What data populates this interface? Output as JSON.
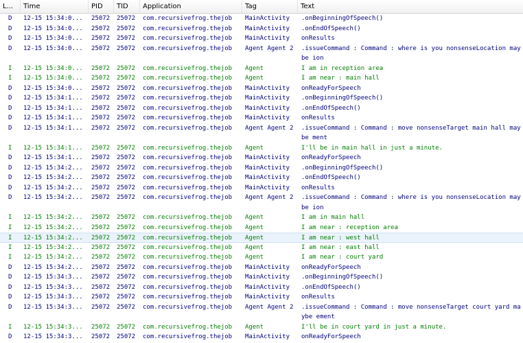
{
  "columns": {
    "level": "L...",
    "time": "Time",
    "pid": "PID",
    "tid": "TID",
    "app": "Application",
    "tag": "Tag",
    "text": "Text"
  },
  "level_colors": {
    "D": "#00007f",
    "I": "#007f00"
  },
  "selected_row_index": 19,
  "rows": [
    {
      "level": "D",
      "time": "12-15 15:34:0...",
      "pid": "25072",
      "tid": "25072",
      "app": "com.recursivefrog.thejob",
      "tag": "MainActivity",
      "text": ".onBeginningOfSpeech()"
    },
    {
      "level": "D",
      "time": "12-15 15:34:0...",
      "pid": "25072",
      "tid": "25072",
      "app": "com.recursivefrog.thejob",
      "tag": "MainActivity",
      "text": ".onEndOfSpeech()"
    },
    {
      "level": "D",
      "time": "12-15 15:34:0...",
      "pid": "25072",
      "tid": "25072",
      "app": "com.recursivefrog.thejob",
      "tag": "MainActivity",
      "text": "onResults"
    },
    {
      "level": "D",
      "time": "12-15 15:34:0...",
      "pid": "25072",
      "tid": "25072",
      "app": "com.recursivefrog.thejob",
      "tag": "Agent Agent 2",
      "text": ".issueCommand : Command : where is you nonsenseLocation maybe ion",
      "wrap": true
    },
    {
      "level": "I",
      "time": "12-15 15:34:0...",
      "pid": "25072",
      "tid": "25072",
      "app": "com.recursivefrog.thejob",
      "tag": "Agent",
      "text": "I am in reception area"
    },
    {
      "level": "I",
      "time": "12-15 15:34:0...",
      "pid": "25072",
      "tid": "25072",
      "app": "com.recursivefrog.thejob",
      "tag": "Agent",
      "text": "I am near : main hall"
    },
    {
      "level": "D",
      "time": "12-15 15:34:0...",
      "pid": "25072",
      "tid": "25072",
      "app": "com.recursivefrog.thejob",
      "tag": "MainActivity",
      "text": "onReadyForSpeech"
    },
    {
      "level": "D",
      "time": "12-15 15:34:1...",
      "pid": "25072",
      "tid": "25072",
      "app": "com.recursivefrog.thejob",
      "tag": "MainActivity",
      "text": ".onBeginningOfSpeech()"
    },
    {
      "level": "D",
      "time": "12-15 15:34:1...",
      "pid": "25072",
      "tid": "25072",
      "app": "com.recursivefrog.thejob",
      "tag": "MainActivity",
      "text": ".onEndOfSpeech()"
    },
    {
      "level": "D",
      "time": "12-15 15:34:1...",
      "pid": "25072",
      "tid": "25072",
      "app": "com.recursivefrog.thejob",
      "tag": "MainActivity",
      "text": "onResults"
    },
    {
      "level": "D",
      "time": "12-15 15:34:1...",
      "pid": "25072",
      "tid": "25072",
      "app": "com.recursivefrog.thejob",
      "tag": "Agent Agent 2",
      "text": ".issueCommand : Command : move nonsenseTarget main hall maybe ment",
      "wrap": true
    },
    {
      "level": "I",
      "time": "12-15 15:34:1...",
      "pid": "25072",
      "tid": "25072",
      "app": "com.recursivefrog.thejob",
      "tag": "Agent",
      "text": "I'll be in main hall in just a minute."
    },
    {
      "level": "D",
      "time": "12-15 15:34:1...",
      "pid": "25072",
      "tid": "25072",
      "app": "com.recursivefrog.thejob",
      "tag": "MainActivity",
      "text": "onReadyForSpeech"
    },
    {
      "level": "D",
      "time": "12-15 15:34:2...",
      "pid": "25072",
      "tid": "25072",
      "app": "com.recursivefrog.thejob",
      "tag": "MainActivity",
      "text": ".onBeginningOfSpeech()"
    },
    {
      "level": "D",
      "time": "12-15 15:34:2...",
      "pid": "25072",
      "tid": "25072",
      "app": "com.recursivefrog.thejob",
      "tag": "MainActivity",
      "text": ".onEndOfSpeech()"
    },
    {
      "level": "D",
      "time": "12-15 15:34:2...",
      "pid": "25072",
      "tid": "25072",
      "app": "com.recursivefrog.thejob",
      "tag": "MainActivity",
      "text": "onResults"
    },
    {
      "level": "D",
      "time": "12-15 15:34:2...",
      "pid": "25072",
      "tid": "25072",
      "app": "com.recursivefrog.thejob",
      "tag": "Agent Agent 2",
      "text": ".issueCommand : Command : where is you nonsenseLocation maybe ion",
      "wrap": true
    },
    {
      "level": "I",
      "time": "12-15 15:34:2...",
      "pid": "25072",
      "tid": "25072",
      "app": "com.recursivefrog.thejob",
      "tag": "Agent",
      "text": "I am in main hall"
    },
    {
      "level": "I",
      "time": "12-15 15:34:2...",
      "pid": "25072",
      "tid": "25072",
      "app": "com.recursivefrog.thejob",
      "tag": "Agent",
      "text": "I am near : reception area"
    },
    {
      "level": "I",
      "time": "12-15 15:34:2...",
      "pid": "25072",
      "tid": "25072",
      "app": "com.recursivefrog.thejob",
      "tag": "Agent",
      "text": "I am near : west hall"
    },
    {
      "level": "I",
      "time": "12-15 15:34:2...",
      "pid": "25072",
      "tid": "25072",
      "app": "com.recursivefrog.thejob",
      "tag": "Agent",
      "text": "I am near : east hall"
    },
    {
      "level": "I",
      "time": "12-15 15:34:2...",
      "pid": "25072",
      "tid": "25072",
      "app": "com.recursivefrog.thejob",
      "tag": "Agent",
      "text": "I am near : court yard"
    },
    {
      "level": "D",
      "time": "12-15 15:34:2...",
      "pid": "25072",
      "tid": "25072",
      "app": "com.recursivefrog.thejob",
      "tag": "MainActivity",
      "text": "onReadyForSpeech"
    },
    {
      "level": "D",
      "time": "12-15 15:34:3...",
      "pid": "25072",
      "tid": "25072",
      "app": "com.recursivefrog.thejob",
      "tag": "MainActivity",
      "text": ".onBeginningOfSpeech()"
    },
    {
      "level": "D",
      "time": "12-15 15:34:3...",
      "pid": "25072",
      "tid": "25072",
      "app": "com.recursivefrog.thejob",
      "tag": "MainActivity",
      "text": ".onEndOfSpeech()"
    },
    {
      "level": "D",
      "time": "12-15 15:34:3...",
      "pid": "25072",
      "tid": "25072",
      "app": "com.recursivefrog.thejob",
      "tag": "MainActivity",
      "text": "onResults"
    },
    {
      "level": "D",
      "time": "12-15 15:34:3...",
      "pid": "25072",
      "tid": "25072",
      "app": "com.recursivefrog.thejob",
      "tag": "Agent Agent 2",
      "text": ".issueCommand : Command : move nonsenseTarget court yard maybe ement",
      "wrap": true
    },
    {
      "level": "I",
      "time": "12-15 15:34:3...",
      "pid": "25072",
      "tid": "25072",
      "app": "com.recursivefrog.thejob",
      "tag": "Agent",
      "text": "I'll be in court yard in just a minute."
    },
    {
      "level": "D",
      "time": "12-15 15:34:3...",
      "pid": "25072",
      "tid": "25072",
      "app": "com.recursivefrog.thejob",
      "tag": "MainActivity",
      "text": "onReadyForSpeech"
    }
  ]
}
